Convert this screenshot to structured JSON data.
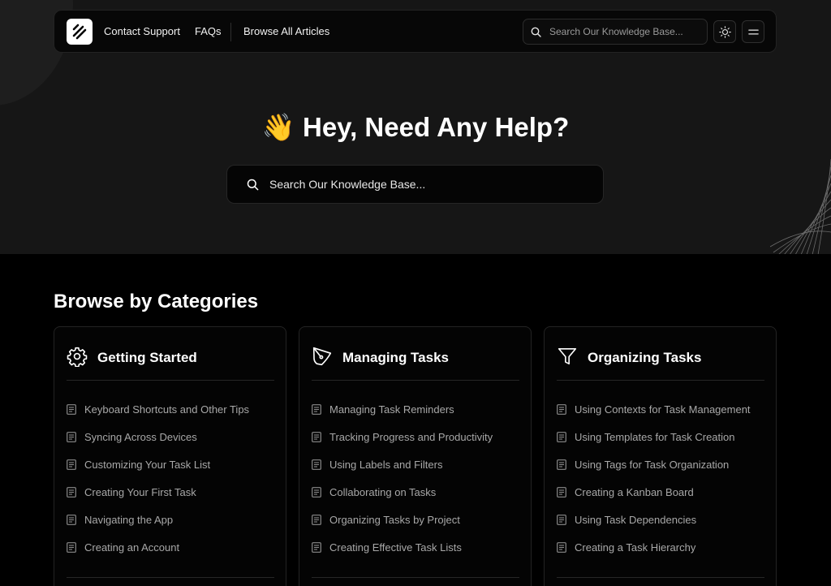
{
  "nav": {
    "links": [
      "Contact Support",
      "FAQs",
      "Browse All Articles"
    ],
    "search_placeholder": "Search Our Knowledge Base...",
    "logo_icon": "slash-logo-icon",
    "theme_icon": "sun-icon",
    "menu_icon": "hamburger-menu-icon"
  },
  "hero": {
    "emoji": "👋",
    "title": "Hey, Need Any Help?",
    "search_placeholder": "Search Our Knowledge Base..."
  },
  "categories": {
    "title": "Browse by Categories",
    "cards": [
      {
        "title": "Getting Started",
        "icon": "gear-icon",
        "items": [
          "Keyboard Shortcuts and Other Tips",
          "Syncing Across Devices",
          "Customizing Your Task List",
          "Creating Your First Task",
          "Navigating the App",
          "Creating an Account"
        ]
      },
      {
        "title": "Managing Tasks",
        "icon": "pen-tool-icon",
        "items": [
          "Managing Task Reminders",
          "Tracking Progress and Productivity",
          "Using Labels and Filters",
          "Collaborating on Tasks",
          "Organizing Tasks by Project",
          "Creating Effective Task Lists"
        ]
      },
      {
        "title": "Organizing Tasks",
        "icon": "filter-icon",
        "items": [
          "Using Contexts for Task Management",
          "Using Templates for Task Creation",
          "Using Tags for Task Organization",
          "Creating a Kanban Board",
          "Using Task Dependencies",
          "Creating a Task Hierarchy"
        ]
      }
    ]
  },
  "colors": {
    "background": "#000000",
    "hero_background": "#161616",
    "text": "#ffffff",
    "muted_text": "#a8a8a8",
    "border": "#232323"
  }
}
